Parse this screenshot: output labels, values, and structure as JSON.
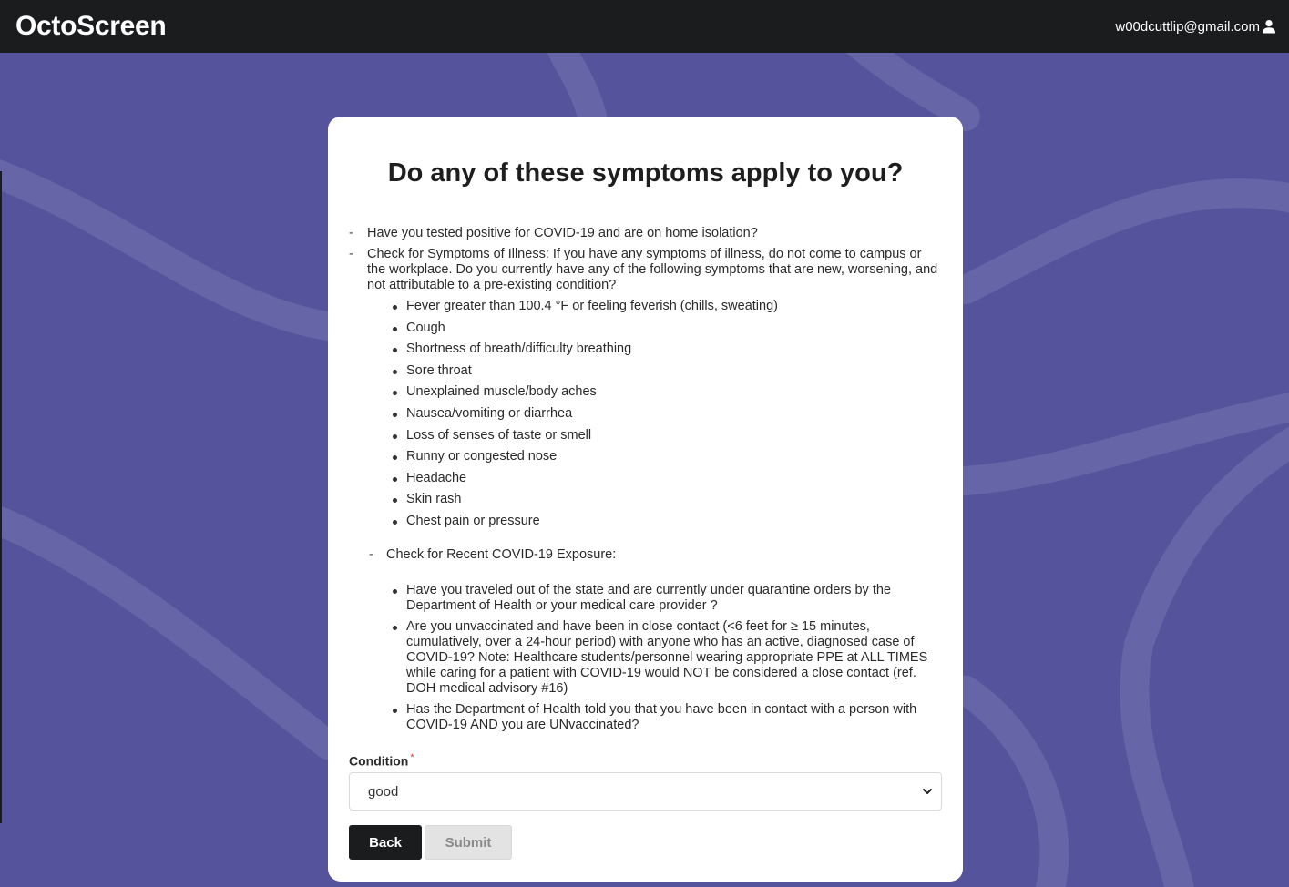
{
  "header": {
    "brand": "OctoScreen",
    "user_email": "w00dcuttlip@gmail.com",
    "user_icon": "user-icon"
  },
  "question": {
    "title": "Do any of these symptoms apply to you?",
    "items": [
      "Have you tested positive for COVID-19 and are on home isolation?",
      "Check for Symptoms of Illness: If you have any symptoms of illness, do not come to campus or the workplace. Do you currently have any of the following symptoms that are new, worsening, and not attributable to a pre-existing condition?"
    ],
    "symptoms": [
      "Fever greater than 100.4 °F or feeling feverish (chills, sweating)",
      "Cough",
      "Shortness of breath/difficulty breathing",
      "Sore throat",
      "Unexplained muscle/body aches",
      "Nausea/vomiting or diarrhea",
      "Loss of senses of taste or smell",
      "Runny or congested nose",
      "Headache",
      "Skin rash",
      "Chest pain or pressure"
    ],
    "exposure_heading": "Check for Recent COVID-19 Exposure:",
    "exposure_items": [
      "Have you traveled out of the state and are currently under quarantine orders by the Department of Health or your medical care provider ?",
      "Are you unvaccinated and have been in close contact (<6 feet for ≥ 15 minutes, cumulatively, over a 24-hour period) with anyone who has an active, diagnosed case of COVID-19? Note: Healthcare students/personnel wearing appropriate PPE at ALL TIMES while caring for a patient with COVID-19 would NOT be considered a close contact (ref. DOH medical advisory #16)",
      "Has the Department of Health told you that you have been in contact with a person with COVID-19 AND you are UNvaccinated?"
    ]
  },
  "form": {
    "condition_label": "Condition",
    "required_mark": "*",
    "condition_value": "good",
    "dropdown_icon": "chevron-down-icon"
  },
  "buttons": {
    "back_label": "Back",
    "submit_label": "Submit"
  },
  "colors": {
    "topbar": "#1b1c1e",
    "background": "#54539b",
    "card": "#ffffff",
    "primary_button": "#1b1c1e",
    "disabled_button": "#e3e3e3"
  }
}
